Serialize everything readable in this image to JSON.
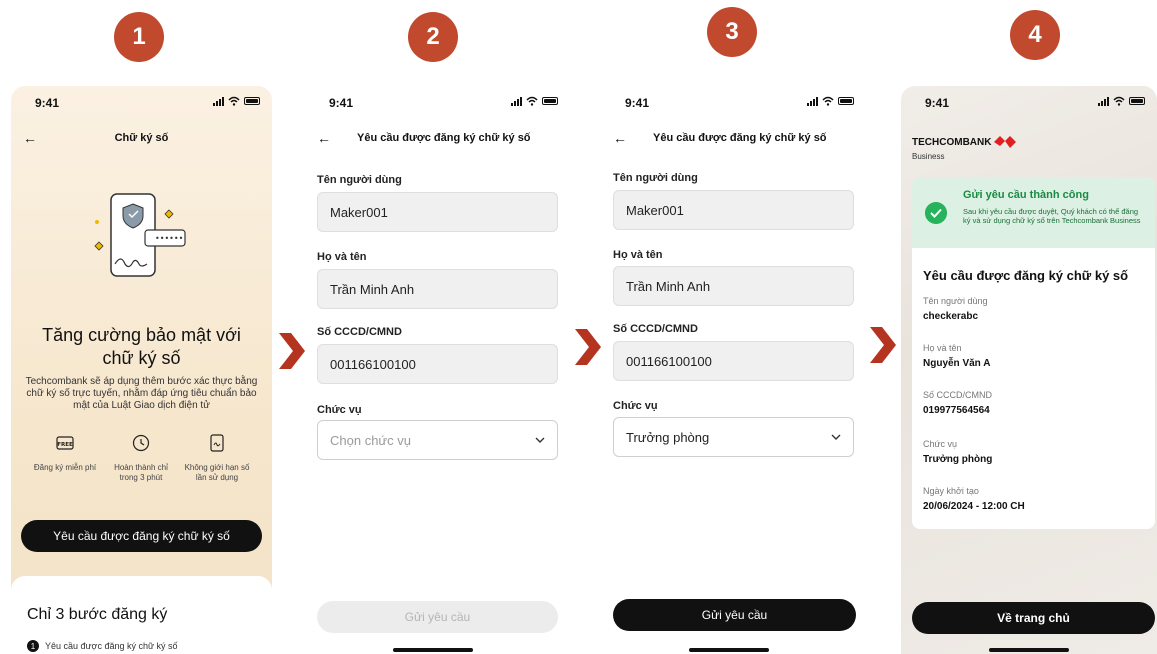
{
  "steps": [
    "1",
    "2",
    "3",
    "4"
  ],
  "status_time": "9:41",
  "colors": {
    "badge": "#c14a2e",
    "accent_red": "#e02020",
    "success_green": "#27b35c"
  },
  "screen1": {
    "nav_title": "Chữ ký số",
    "title": "Tăng cường bảo mật với chữ ký số",
    "description": "Techcombank sẽ áp dụng thêm bước xác thực bằng chữ ký số trực tuyến, nhằm đáp ứng tiêu chuẩn bảo mật của Luật Giao dịch điện tử",
    "features": [
      {
        "icon": "free-icon",
        "label": "Đăng ký miễn phí",
        "badge": "FREE"
      },
      {
        "icon": "clock-icon",
        "label": "Hoàn thành chỉ trong 3 phút"
      },
      {
        "icon": "signature-icon",
        "label": "Không giới hạn số lần sử dụng"
      }
    ],
    "cta": "Yêu cầu được đăng ký chữ ký số",
    "bottom_title": "Chỉ 3 bước đăng ký",
    "bottom_step_num": "1",
    "bottom_step_label": "Yêu cầu được đăng ký chữ ký số"
  },
  "screen2": {
    "nav_title": "Yêu cầu được đăng ký chữ ký số",
    "username_label": "Tên người dùng",
    "username_value": "Maker001",
    "fullname_label": "Họ và tên",
    "fullname_value": "Trần Minh Anh",
    "id_label": "Số CCCD/CMND",
    "id_value": "001166100100",
    "position_label": "Chức vụ",
    "position_placeholder": "Chọn chức vụ",
    "submit": "Gửi yêu cầu"
  },
  "screen3": {
    "nav_title": "Yêu cầu được đăng ký chữ ký số",
    "username_label": "Tên người dùng",
    "username_value": "Maker001",
    "fullname_label": "Họ và tên",
    "fullname_value": "Trần Minh Anh",
    "id_label": "Số CCCD/CMND",
    "id_value": "001166100100",
    "position_label": "Chức vụ",
    "position_value": "Trưởng phòng",
    "submit": "Gửi yêu cầu"
  },
  "screen4": {
    "logo_part1": "TECHCOM",
    "logo_part2": "BANK",
    "logo_sub": "Business",
    "success_title": "Gửi yêu cầu thành công",
    "success_desc": "Sau khi yêu cầu được duyệt, Quý khách có thể đăng ký và sử dụng chữ ký số trên Techcombank Business",
    "card_title": "Yêu cầu được đăng ký chữ ký số",
    "items": [
      {
        "label": "Tên người dùng",
        "value": "checkerabc"
      },
      {
        "label": "Họ và tên",
        "value": "Nguyễn Văn A"
      },
      {
        "label": "Số CCCD/CMND",
        "value": "019977564564"
      },
      {
        "label": "Chức vụ",
        "value": "Trưởng phòng"
      },
      {
        "label": "Ngày khởi tạo",
        "value": "20/06/2024 - 12:00 CH"
      }
    ],
    "home_button": "Về trang chủ"
  }
}
